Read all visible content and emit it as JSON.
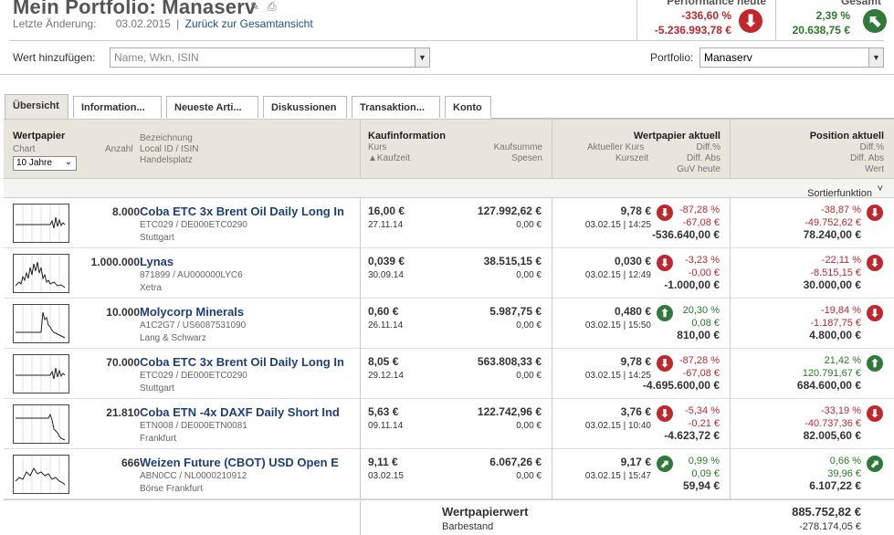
{
  "header": {
    "title": "Mein Portfolio: Manaserv",
    "last_change_label": "Letzte Änderung:",
    "last_change_date": "03.02.2015",
    "separator": "|",
    "back_link": "Zurück zur Gesamtansicht",
    "perf_today_label": "Performance heute",
    "perf_today_pct": "-336,60 %",
    "perf_today_abs": "-5.236.993,78 €",
    "total_label": "Gesamt",
    "total_pct": "2,39 %",
    "total_abs": "20.638,75 €"
  },
  "controls": {
    "add_label": "Wert hinzufügen:",
    "add_placeholder": "Name, Wkn, ISIN",
    "portfolio_label": "Portfolio:",
    "portfolio_value": "Manaserv"
  },
  "tabs": [
    {
      "label": "Übersicht"
    },
    {
      "label": "Information..."
    },
    {
      "label": "Neueste Arti..."
    },
    {
      "label": "Diskussionen"
    },
    {
      "label": "Transaktion..."
    },
    {
      "label": "Konto"
    }
  ],
  "table_header": {
    "wertpapier": "Wertpapier",
    "chart": "Chart",
    "chart_select": "10 Jahre",
    "anzahl": "Anzahl",
    "bezeichnung": "Bezeichnung",
    "local_id": "Local ID / ISIN",
    "handelsplatz": "Handelsplatz",
    "kaufinfo": "Kaufinformation",
    "kurs": "Kurs",
    "kaufzeit": "Kaufzeit",
    "kaufsumme": "Kaufsumme",
    "spesen": "Spesen",
    "wp_aktuell": "Wertpapier aktuell",
    "akt_kurs": "Aktueller Kurs",
    "kurszeit": "Kurszeit",
    "diff_pct": "Diff.%",
    "diff_abs": "Diff. Abs",
    "guv": "GuV heute",
    "pos_aktuell": "Position aktuell",
    "p_diff_pct": "Diff.%",
    "p_diff_abs": "Diff. Abs",
    "wert": "Wert"
  },
  "sort_label": "Sortierfunktion einblenden",
  "rows": [
    {
      "anzahl": "8.000",
      "name": "Coba ETC 3x Brent Oil Daily Long In",
      "ids": "ETC029 / DE000ETC0290",
      "place": "Stuttgart",
      "kurs": "16,00 €",
      "kaufzeit": "27.11.14",
      "kaufsumme": "127.992,62 €",
      "spesen": "0,00 €",
      "akt": "9,78 €",
      "kurszeit": "03.02.15 | 14:25",
      "dpct": "-87,28 %",
      "dabs": "-67,08 €",
      "guv": "-536.640,00 €",
      "dir": "dn",
      "p_pct": "-38,87 %",
      "p_abs": "-49.752,62 €",
      "wert": "78.240,00 €",
      "pdir": "dn"
    },
    {
      "anzahl": "1.000.000",
      "name": "Lynas",
      "ids": "871899 / AU000000LYC6",
      "place": "Xetra",
      "kurs": "0,039 €",
      "kaufzeit": "30.09.14",
      "kaufsumme": "38.515,15 €",
      "spesen": "0,00 €",
      "akt": "0,030 €",
      "kurszeit": "03.02.15 | 12:49",
      "dpct": "-3,23 %",
      "dabs": "-0,00 €",
      "guv": "-1.000,00 €",
      "dir": "dn",
      "p_pct": "-22,11 %",
      "p_abs": "-8.515,15 €",
      "wert": "30.000,00 €",
      "pdir": "dn"
    },
    {
      "anzahl": "10.000",
      "name": "Molycorp Minerals",
      "ids": "A1C2G7 / US6087531090",
      "place": "Lang & Schwarz",
      "kurs": "0,60 €",
      "kaufzeit": "26.11.14",
      "kaufsumme": "5.987,75 €",
      "spesen": "0,00 €",
      "akt": "0,480 €",
      "kurszeit": "03.02.15 | 15:50",
      "dpct": "20,30 %",
      "dabs": "0,08 €",
      "guv": "810,00 €",
      "dir": "up",
      "p_pct": "-19,84 %",
      "p_abs": "-1.187,75 €",
      "wert": "4.800,00 €",
      "pdir": "dn"
    },
    {
      "anzahl": "70.000",
      "name": "Coba ETC 3x Brent Oil Daily Long In",
      "ids": "ETC029 / DE000ETC0290",
      "place": "Stuttgart",
      "kurs": "8,05 €",
      "kaufzeit": "29.12.14",
      "kaufsumme": "563.808,33 €",
      "spesen": "0,00 €",
      "akt": "9,78 €",
      "kurszeit": "03.02.15 | 14:25",
      "dpct": "-87,28 %",
      "dabs": "-67,08 €",
      "guv": "-4.695.600,00 €",
      "dir": "dn",
      "p_pct": "21,42 %",
      "p_abs": "120.791,67 €",
      "wert": "684.600,00 €",
      "pdir": "up"
    },
    {
      "anzahl": "21.810",
      "name": "Coba ETN -4x DAXF Daily Short Ind",
      "ids": "ETN008 / DE000ETN0081",
      "place": "Frankfurt",
      "kurs": "5,63 €",
      "kaufzeit": "09.11.14",
      "kaufsumme": "122.742,96 €",
      "spesen": "0,00 €",
      "akt": "3,76 €",
      "kurszeit": "03.02.15 | 10:40",
      "dpct": "-5,34 %",
      "dabs": "-0,21 €",
      "guv": "-4.623,72 €",
      "dir": "dn",
      "p_pct": "-33,19 %",
      "p_abs": "-40.737,36 €",
      "wert": "82.005,60 €",
      "pdir": "dn"
    },
    {
      "anzahl": "666",
      "name": "Weizen Future (CBOT) USD Open E",
      "ids": "ABN0CC / NL0000210912",
      "place": "Börse Frankfurt",
      "kurs": "9,11 €",
      "kaufzeit": "03.02.15",
      "kaufsumme": "6.067,26 €",
      "spesen": "0,00 €",
      "akt": "9,17 €",
      "kurszeit": "03.02.15 | 15:47",
      "dpct": "0,99 %",
      "dabs": "0,09 €",
      "guv": "59,94 €",
      "dir": "ur",
      "p_pct": "0,66 %",
      "p_abs": "39,96 €",
      "wert": "6.107,22 €",
      "pdir": "ur"
    }
  ],
  "footer": {
    "wertpapierwert_label": "Wertpapierwert",
    "wertpapierwert": "885.752,82 €",
    "barbestand_label": "Barbestand",
    "barbestand": "-278.174,05 €"
  }
}
